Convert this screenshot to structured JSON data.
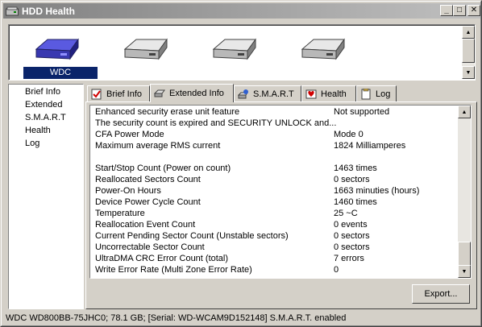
{
  "window": {
    "title": "HDD Health",
    "min_glyph": "_",
    "max_glyph": "□",
    "close_glyph": "✕"
  },
  "drives": [
    {
      "label": "WDC",
      "selected": true,
      "color": "#4040c8"
    },
    {
      "label": "",
      "selected": false,
      "color": "#b0b0b0"
    },
    {
      "label": "",
      "selected": false,
      "color": "#b0b0b0"
    },
    {
      "label": "",
      "selected": false,
      "color": "#b0b0b0"
    }
  ],
  "nav": {
    "items": [
      {
        "label": "Brief Info"
      },
      {
        "label": "Extended"
      },
      {
        "label": "S.M.A.R.T"
      },
      {
        "label": "Health"
      },
      {
        "label": "Log"
      }
    ]
  },
  "tabs": [
    {
      "label": "Brief Info",
      "icon": "brief-info-icon"
    },
    {
      "label": "Extended Info",
      "icon": "extended-info-icon",
      "active": true
    },
    {
      "label": "S.M.A.R.T",
      "icon": "smart-icon"
    },
    {
      "label": "Health",
      "icon": "health-icon"
    },
    {
      "label": "Log",
      "icon": "log-icon"
    }
  ],
  "info_rows": [
    {
      "key": "Enhanced security erase unit feature",
      "value": "Not supported"
    },
    {
      "key": "The security count is expired and SECURITY UNLOCK and...",
      "value": ""
    },
    {
      "key": "CFA Power Mode",
      "value": "Mode 0"
    },
    {
      "key": "Maximum average RMS current",
      "value": "1824 Milliamperes"
    },
    {
      "key": "",
      "value": ""
    },
    {
      "key": "Start/Stop Count (Power on count)",
      "value": "1463 times"
    },
    {
      "key": "Reallocated Sectors Count",
      "value": "0 sectors"
    },
    {
      "key": "Power-On Hours",
      "value": "1663 minuties (hours)"
    },
    {
      "key": "Device Power Cycle Count",
      "value": "1460 times"
    },
    {
      "key": "Temperature",
      "value": "25 ~C"
    },
    {
      "key": "Reallocation Event Count",
      "value": "0 events"
    },
    {
      "key": "Current Pending Sector Count (Unstable sectors)",
      "value": "0 sectors"
    },
    {
      "key": "Uncorrectable Sector Count",
      "value": "0 sectors"
    },
    {
      "key": "UltraDMA CRC Error Count (total)",
      "value": "7 errors"
    },
    {
      "key": "Write Error Rate (Multi Zone Error Rate)",
      "value": "0"
    }
  ],
  "export_label": "Export...",
  "status_text": "WDC WD800BB-75JHC0;   78.1 GB;  [Serial: WD-WCAM9D152148]    S.M.A.R.T. enabled",
  "colors": {
    "selection": "#0a246a",
    "face": "#d4d0c8"
  }
}
